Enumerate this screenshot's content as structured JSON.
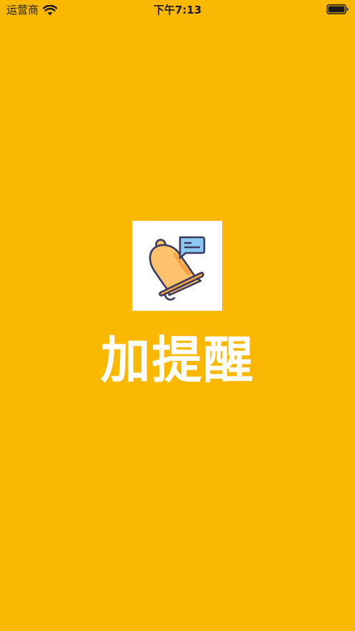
{
  "status_bar": {
    "carrier": "运营商",
    "time": "下午7:13",
    "wifi_icon": "wifi-icon",
    "battery_icon": "battery-icon"
  },
  "splash": {
    "app_icon": "bell-with-chat-bubble-icon",
    "app_name": "加提醒"
  },
  "colors": {
    "background": "#FAB803",
    "title": "#FFFFFF",
    "icon_tile": "#FFFFFF",
    "bell": "#FDC26B",
    "bell_shade": "#F5A244",
    "bubble": "#8CC8F2",
    "outline": "#3C3B5E"
  }
}
